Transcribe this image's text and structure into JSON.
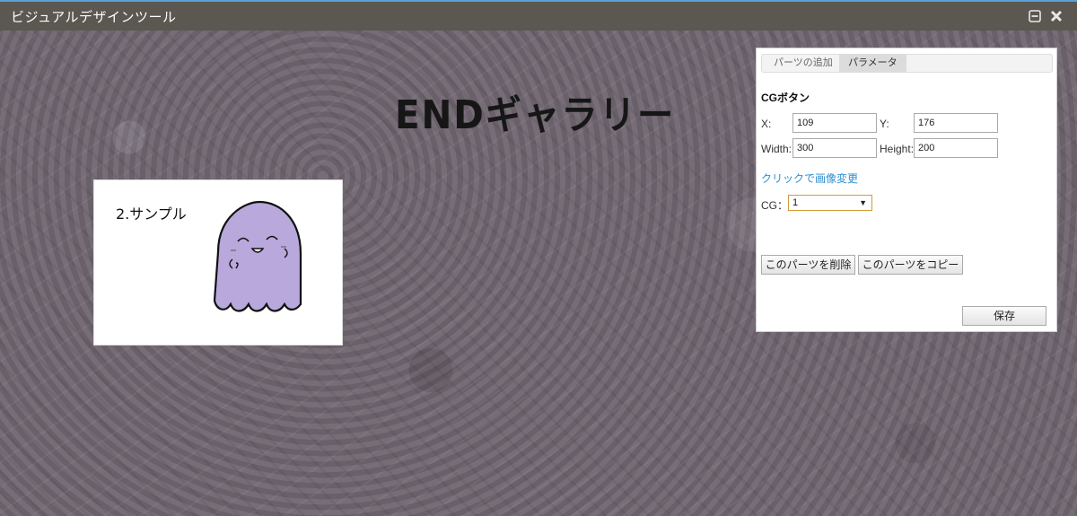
{
  "window": {
    "title": "ビジュアルデザインツール",
    "icons": [
      "minimize-icon",
      "close-icon"
    ]
  },
  "canvas": {
    "heading": "ENDギャラリー",
    "cg_button": {
      "label": "2.サンプル"
    }
  },
  "panel": {
    "tabs": [
      {
        "label": "パーツの追加",
        "active": false
      },
      {
        "label": "パラメータ",
        "active": true
      }
    ],
    "title": "CGボタン",
    "fields": {
      "x": {
        "label": "X:",
        "value": "109"
      },
      "y": {
        "label": "Y:",
        "value": "176"
      },
      "width": {
        "label": "Width:",
        "value": "300"
      },
      "height": {
        "label": "Height:",
        "value": "200"
      }
    },
    "image_link": "クリックで画像変更",
    "cg_select": {
      "label": "CG：",
      "value": "1"
    },
    "delete_button": "このパーツを削除",
    "copy_button": "このパーツをコピー",
    "save_button": "保存"
  },
  "colors": {
    "titlebar": "#5b5751",
    "link": "#2b8fd0",
    "ghost": "#b9a8dc",
    "select_border": "#d39a3a"
  }
}
